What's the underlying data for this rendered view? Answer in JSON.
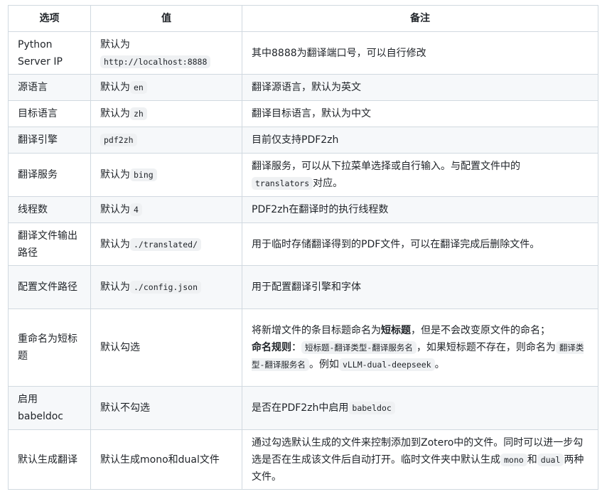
{
  "headers": {
    "option": "选项",
    "value": "值",
    "note": "备注"
  },
  "rows": [
    {
      "option": "Python Server IP",
      "value_prefix": "默认为",
      "value_code": "http://localhost:8888",
      "note": "其中8888为翻译端口号，可以自行修改"
    },
    {
      "option": "源语言",
      "value_prefix": "默认为",
      "value_code": "en",
      "note": "翻译源语言，默认为英文"
    },
    {
      "option": "目标语言",
      "value_prefix": "默认为",
      "value_code": "zh",
      "note": "翻译目标语言，默认为中文"
    },
    {
      "option": "翻译引擎",
      "value_code": "pdf2zh",
      "note": "目前仅支持PDF2zh"
    },
    {
      "option": "翻译服务",
      "value_prefix": "默认为",
      "value_code": "bing",
      "note_1": "翻译服务，可以从下拉菜单选择或自行输入。与配置文件中的",
      "note_code": "translators",
      "note_2": "对应。"
    },
    {
      "option": "线程数",
      "value_prefix": "默认为",
      "value_code": "4",
      "note": "PDF2zh在翻译时的执行线程数"
    },
    {
      "option": "翻译文件输出路径",
      "value_prefix": "默认为",
      "value_code": "./translated/",
      "note": "用于临时存储翻译得到的PDF文件，可以在翻译完成后删除文件。"
    },
    {
      "option": "配置文件路径",
      "value_prefix": "默认为",
      "value_code": "./config.json",
      "note": "用于配置翻译引擎和字体"
    },
    {
      "option": "重命名为短标题",
      "value": "默认勾选",
      "note_1": "将新增文件的条目标题命名为",
      "note_bold": "短标题",
      "note_2": "，但是不会改变原文件的命名；",
      "rule_label": "命名规则",
      "rule_colon": "：",
      "rule_code1": "短标题-翻译类型-翻译服务名",
      "rule_text1": "，如果短标题不存在，则命名为",
      "rule_code2": "翻译类型-翻译服务名",
      "rule_text2": "。例如",
      "rule_code3": "vLLM-dual-deepseek",
      "rule_text3": "。"
    },
    {
      "option": "启用babeldoc",
      "value": "默认不勾选",
      "note_1": "是否在PDF2zh中启用",
      "note_code": "babeldoc"
    },
    {
      "option": "默认生成翻译",
      "value": "默认生成mono和dual文件",
      "note_1": "通过勾选默认生成的文件来控制添加到Zotero中的文件。同时可以进一步勾选是否在生成该文件后自动打开。临时文件夹中默认生成",
      "note_code1": "mono",
      "note_mid": "和",
      "note_code2": "dual",
      "note_2": "两种文件。"
    }
  ]
}
